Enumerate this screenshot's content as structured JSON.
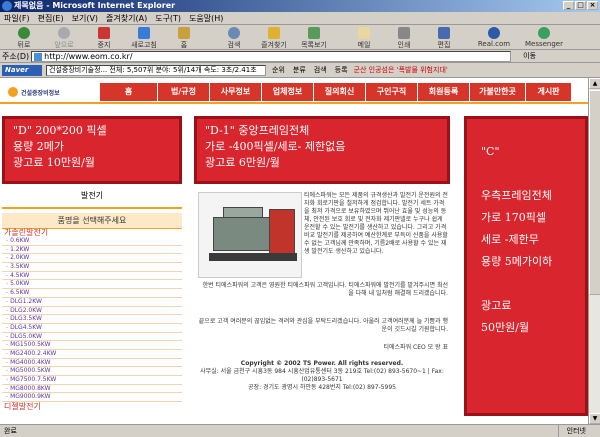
{
  "window": {
    "title": "제목없음 - Microsoft Internet Explorer",
    "buttons": [
      "_",
      "□",
      "×"
    ]
  },
  "menubar": [
    "파일(F)",
    "편집(E)",
    "보기(V)",
    "즐겨찾기(A)",
    "도구(T)",
    "도움말(H)"
  ],
  "toolbar": {
    "back": "뒤로",
    "forward": "앞으로",
    "stop": "중지",
    "refresh": "새로고침",
    "home": "홈",
    "search": "검색",
    "favorites": "즐겨찾기",
    "history": "목록보기",
    "mail": "메일",
    "print": "인쇄",
    "edit": "편집",
    "real": "Real.com",
    "messenger": "Messenger"
  },
  "address": {
    "label": "주소(D)",
    "url": "http://www.eom.co.kr/",
    "go": "이동"
  },
  "naverbar": {
    "logo": "Naver",
    "ticker": "건설중장비기술정... 전체: 5,507위  분야: 5위/14개  속도: 3초/2.41초",
    "rank_btn": "순위",
    "category_btn": "분류",
    "search_btn": "검색",
    "register_btn": "등록",
    "news": "군산 인공섬은 '폭발물 위험지대'"
  },
  "site": {
    "logo_text": "건설중장비정보",
    "nav": [
      "홈",
      "법/규정",
      "사무정보",
      "업체정보",
      "질의회신",
      "구인구직",
      "회원등록",
      "가불만한곳",
      "게시판"
    ]
  },
  "ads": {
    "left": [
      "\"D\" 200*200 픽셀",
      "용량 2메가",
      "광고료 10만원/월"
    ],
    "mid": [
      "\"D-1\" 중앙프레임전체",
      "가로 -400픽셀/세로- 제한없음",
      "광고료 6만원/월"
    ],
    "right": [
      "\"C\"",
      "우측프레임전체",
      "가로 170픽셀",
      "세로 -제한무",
      "용량 5메가이하",
      "광고료",
      "50만원/월"
    ]
  },
  "left_panel": {
    "title": "발전기",
    "category_header": "품명을 선택해주세요",
    "parent": "가솔린발전기",
    "items": [
      "0.6KW",
      "1.2KW",
      "2.0KW",
      "3.5KW",
      "4.5KW",
      "5.0KW",
      "6.5KW",
      "DLG1.2KW",
      "DLG2.0KW",
      "DLG3.5KW",
      "DLG4.5KW",
      "DLG5.0KW",
      "MG1500.5KW",
      "MG2400.2.4KW",
      "MG4000.4KW",
      "MG5000.5KW",
      "MG7500.7.5KW",
      "MG8000.8KW",
      "MG9000.9KW"
    ],
    "next_parent": "디젤발전기"
  },
  "main": {
    "para1": "티에스파워는 모든 제품의 규격생산과 발전기 운전원의 전자화 회로기판을 철저하게 점검합니다. 발전기 세트 가격을 최저 가격으로 보유하였으며 뛰어난 효율 및 성능의 동체, 안전된 보호 회로 및 전자화 제기판넬로 누구나 쉽게 운전할 수 있는 발전기를 생산하고 있습니다. 그리고 가격 비교 발전기를 제공하여 예산한계로 부득이 신품을 사용할 수 없는 고객님께 만족하며, 기름2배로 사용할 수 있는 재생 발전기도 생산하고 있습니다.",
    "para2": "한번 티에스파워의 고객은 영원한 티에스파워 고객입니다. 티에스파워에 발전기를 맡겨주시면 최선을 다해 내 일처럼 해결해 드리겠습니다.",
    "para3": "끝으로 고객 여러분의 끊임없는 격려와 관심을 부탁드리겠습니다. 아울러 고객여러분께 늘 기쁨과 행운이 깃드시길 기원합니다.",
    "signature": "티에스파워 CEO 모 왕 표",
    "footer": {
      "copyright": "Copyright © 2002 TS Power. All rights reserved.",
      "address": "사무실: 서울 금천구 시흥3동 984 시흥산업유통센터 3동 219호 Tel:(02) 893-5670~1 | Fax:(02)893-5671",
      "factory": "공장: 경기도 광명시 하안동 428번지 Tel:(02) 897-5995"
    }
  },
  "status": {
    "left": "완료",
    "zone": "인터넷"
  }
}
